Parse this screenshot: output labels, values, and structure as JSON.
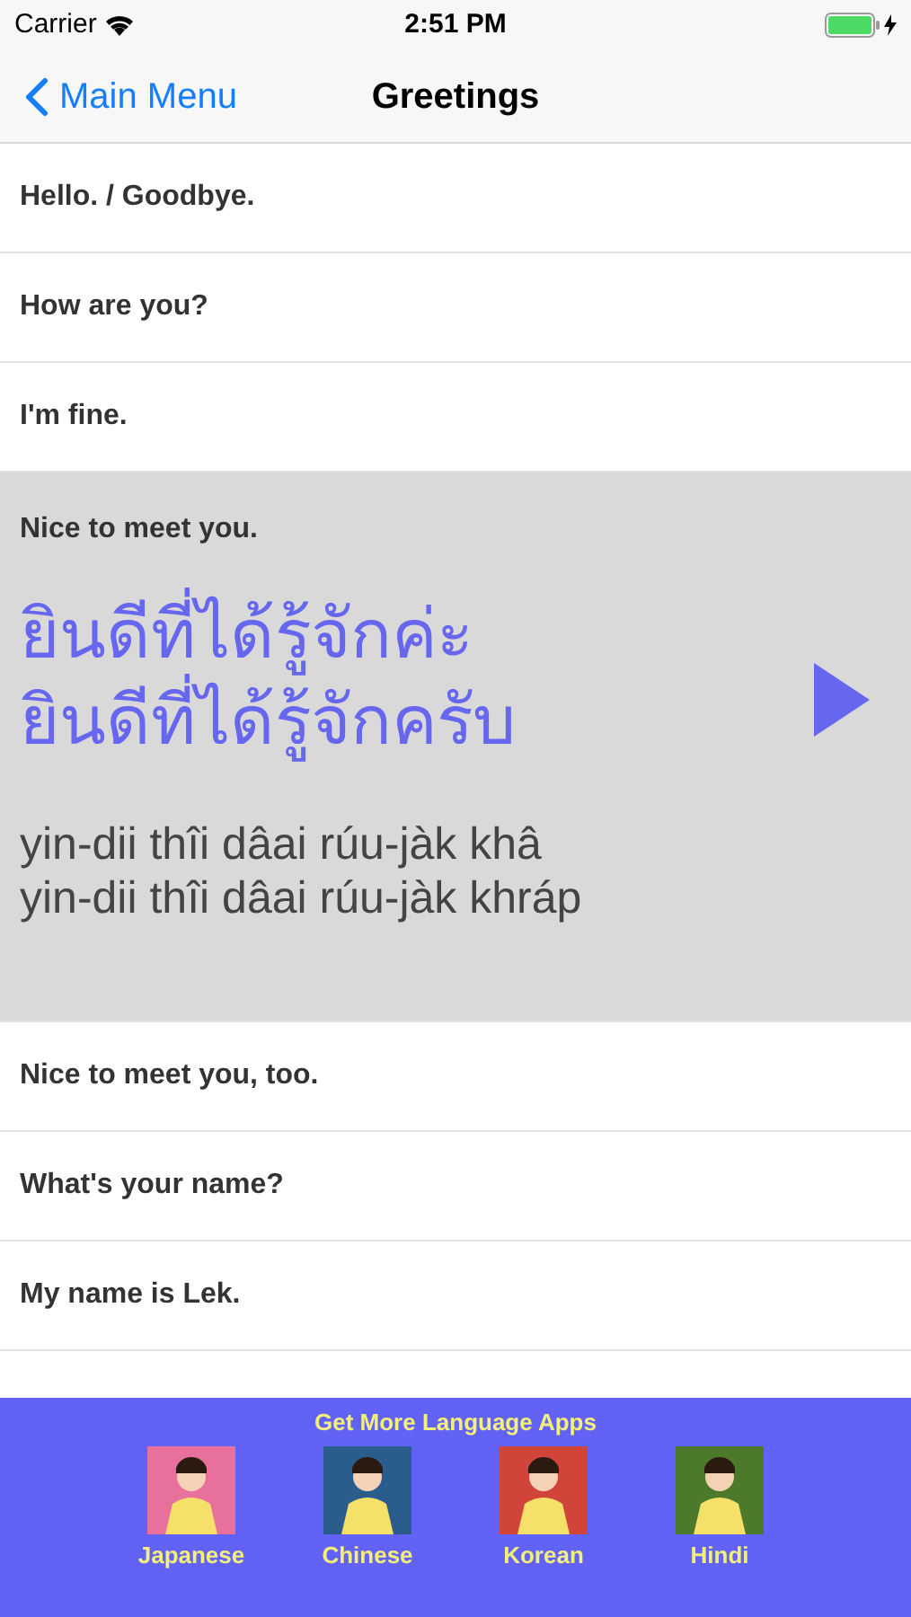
{
  "status_bar": {
    "carrier": "Carrier",
    "time": "2:51 PM"
  },
  "nav": {
    "back": "Main Menu",
    "title": "Greetings"
  },
  "phrases": [
    {
      "english": "Hello. / Goodbye.",
      "expanded": false
    },
    {
      "english": "How are you?",
      "expanded": false
    },
    {
      "english": "I'm fine.",
      "expanded": false
    },
    {
      "english": "Nice to meet you.",
      "expanded": true,
      "thai": [
        "ยินดีที่ได้รู้จักค่ะ",
        "ยินดีที่ได้รู้จักครับ"
      ],
      "romanization": [
        "yin-dii thîi dâai rúu-jàk khâ",
        "yin-dii thîi dâai rúu-jàk khráp"
      ]
    },
    {
      "english": "Nice to meet you, too.",
      "expanded": false
    },
    {
      "english": "What's your name?",
      "expanded": false
    },
    {
      "english": "My name is Lek.",
      "expanded": false
    }
  ],
  "banner": {
    "title": "Get More Language Apps",
    "apps": [
      {
        "label": "Japanese",
        "color": "#e8709c"
      },
      {
        "label": "Chinese",
        "color": "#2a5d8c"
      },
      {
        "label": "Korean",
        "color": "#d0443a"
      },
      {
        "label": "Hindi",
        "color": "#4d7a2a"
      }
    ]
  }
}
